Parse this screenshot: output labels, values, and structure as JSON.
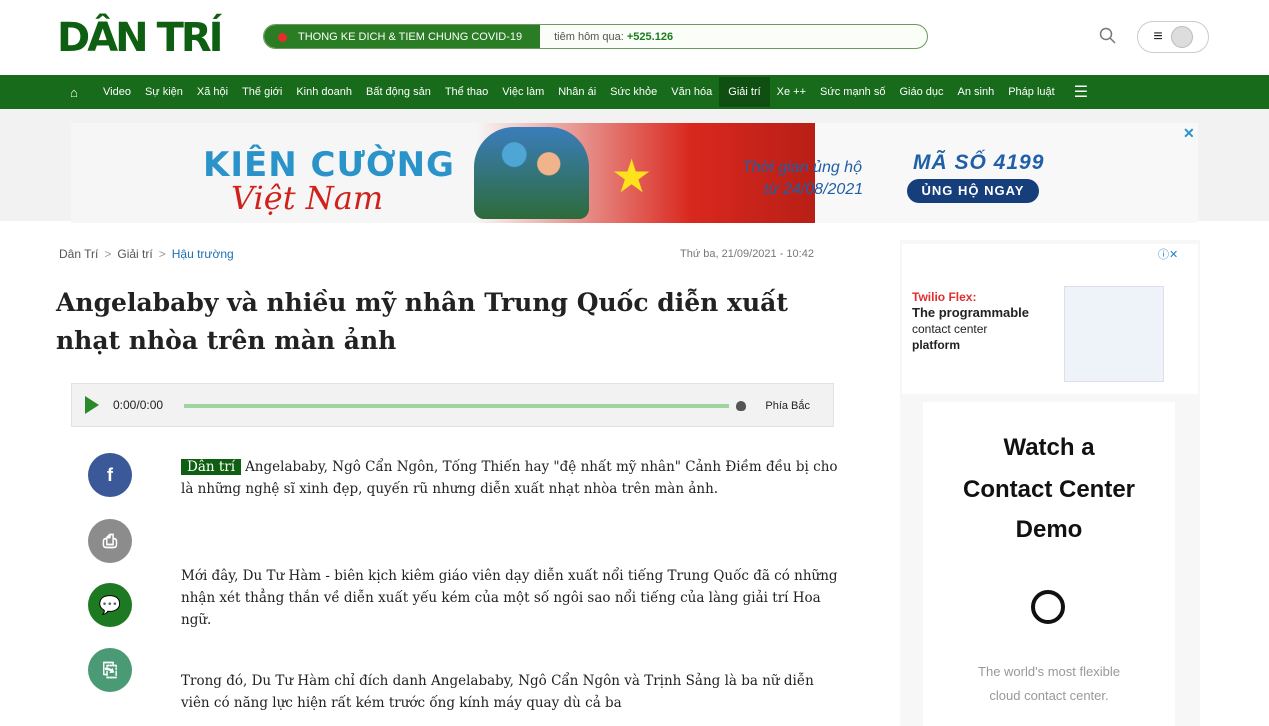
{
  "header": {
    "logo": "DÂN TRÍ",
    "covid_title": "THONG KE DICH & TIEM CHUNG COVID-19",
    "covid_stat_label": "tiêm hôm qua: ",
    "covid_stat_value": "+525.126",
    "menu_icon": "≡"
  },
  "nav": {
    "items": [
      "Video",
      "Sự kiện",
      "Xã hội",
      "Thế giới",
      "Kinh doanh",
      "Bất động sản",
      "Thể thao",
      "Việc làm",
      "Nhân ái",
      "Sức khỏe",
      "Văn hóa",
      "Giải trí",
      "Xe ++",
      "Sức mạnh số",
      "Giáo dục",
      "An sinh",
      "Pháp luật"
    ],
    "active": "Giải trí"
  },
  "ad": {
    "brand_line1": "KIÊN CƯỜNG",
    "brand_line2": "Việt Nam",
    "time_line1": "Thời gian ủng hộ",
    "time_line2": "từ 24/08/2021",
    "code": "MÃ SỐ 4199",
    "cta": "ỦNG HỘ NGAY",
    "close": "✕"
  },
  "article": {
    "breadcrumb": [
      "Dân Trí",
      "Giải trí",
      "Hậu trường"
    ],
    "date": "Thứ ba, 21/09/2021 - 10:42",
    "title": "Angelababy và nhiều mỹ nhân Trung Quốc diễn xuất nhạt nhòa trên màn ảnh",
    "audio_time": "0:00/0:00",
    "audio_voice": "Phía Bắc",
    "source_badge": "Dân trí",
    "p1": "Angelababy, Ngô Cẩn Ngôn, Tống Thiến hay \"đệ nhất mỹ nhân\" Cảnh Điềm đều bị cho là những nghệ sĩ xinh đẹp, quyến rũ nhưng diễn xuất nhạt nhòa trên màn ảnh.",
    "p2": "Mới đây, Du Tư Hàm - biên kịch kiêm giáo viên dạy diễn xuất nổi tiếng Trung Quốc đã có những nhận xét thẳng thắn về diễn xuất yếu kém của một số ngôi sao nổi tiếng của làng giải trí Hoa ngữ.",
    "p3": "Trong đó, Du Tư Hàm chỉ đích danh Angelababy, Ngô Cẩn Ngôn và Trịnh Sảng là ba nữ diễn viên có năng lực hiện rất kém trước ống kính máy quay dù cả ba"
  },
  "sidebar": {
    "ad1_twilio": "Twilio Flex:",
    "ad1_prog": "The programmable",
    "ad1_cc": "contact center",
    "ad1_plat": "platform",
    "ad2_line1": "Watch a",
    "ad2_line2": "Contact Center",
    "ad2_line3": "Demo",
    "ad2_tag1": "The world's most flexible",
    "ad2_tag2": "cloud contact center."
  }
}
